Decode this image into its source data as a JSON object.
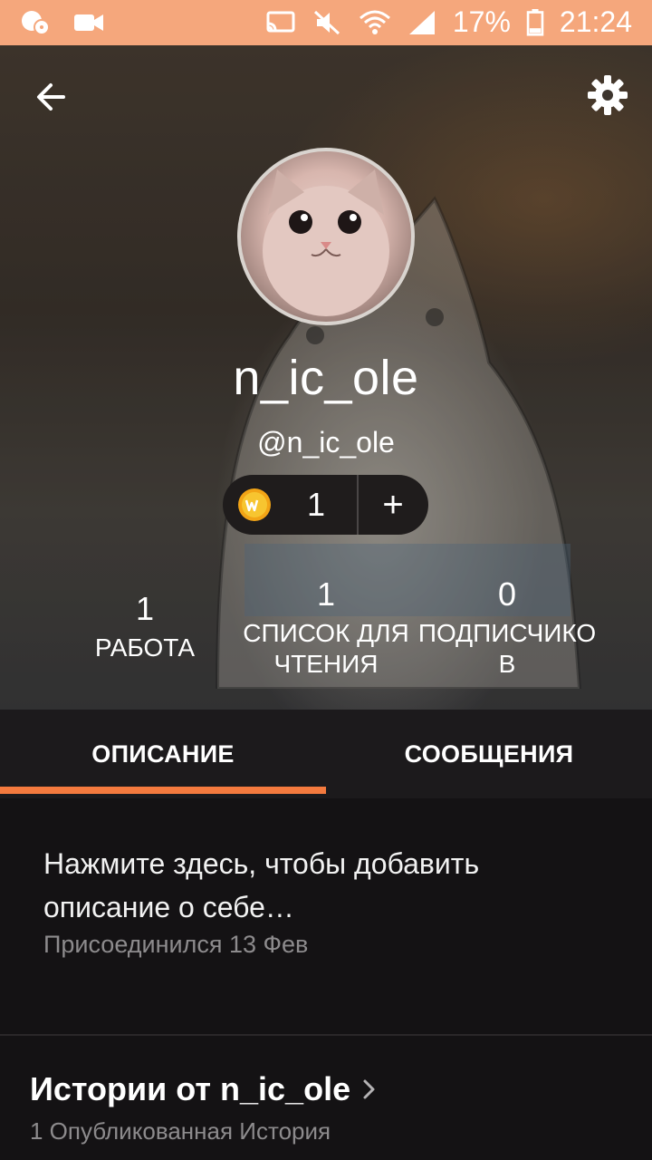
{
  "status_bar": {
    "battery": "17%",
    "time": "21:24",
    "icons": [
      "notification-icon",
      "video-call-icon",
      "cast-icon",
      "mute-icon",
      "wifi-icon",
      "signal-icon",
      "battery-icon"
    ]
  },
  "header": {
    "back_icon": "arrow-left-icon",
    "settings_icon": "gear-icon",
    "display_name": "n_ic_ole",
    "handle": "@n_ic_ole",
    "coins": {
      "count": "1",
      "add_label": "+"
    }
  },
  "stats": [
    {
      "value": "1",
      "label": "РАБОТА"
    },
    {
      "value": "1",
      "label": "СПИСОК ДЛЯ\nЧТЕНИЯ"
    },
    {
      "value": "0",
      "label": "ПОДПИСЧИКО\nВ"
    }
  ],
  "tabs": [
    {
      "label": "ОПИСАНИЕ",
      "active": true
    },
    {
      "label": "СООБЩЕНИЯ",
      "active": false
    }
  ],
  "about": {
    "prompt": "Нажмите здесь, чтобы добавить описание о себе…",
    "joined": "Присоединился 13 Фев"
  },
  "stories": {
    "title": "Истории от n_ic_ole",
    "subtitle": "1 Опубликованная История"
  },
  "colors": {
    "status_bar": "#f5a77c",
    "accent": "#f47a3e",
    "background": "#141214"
  }
}
